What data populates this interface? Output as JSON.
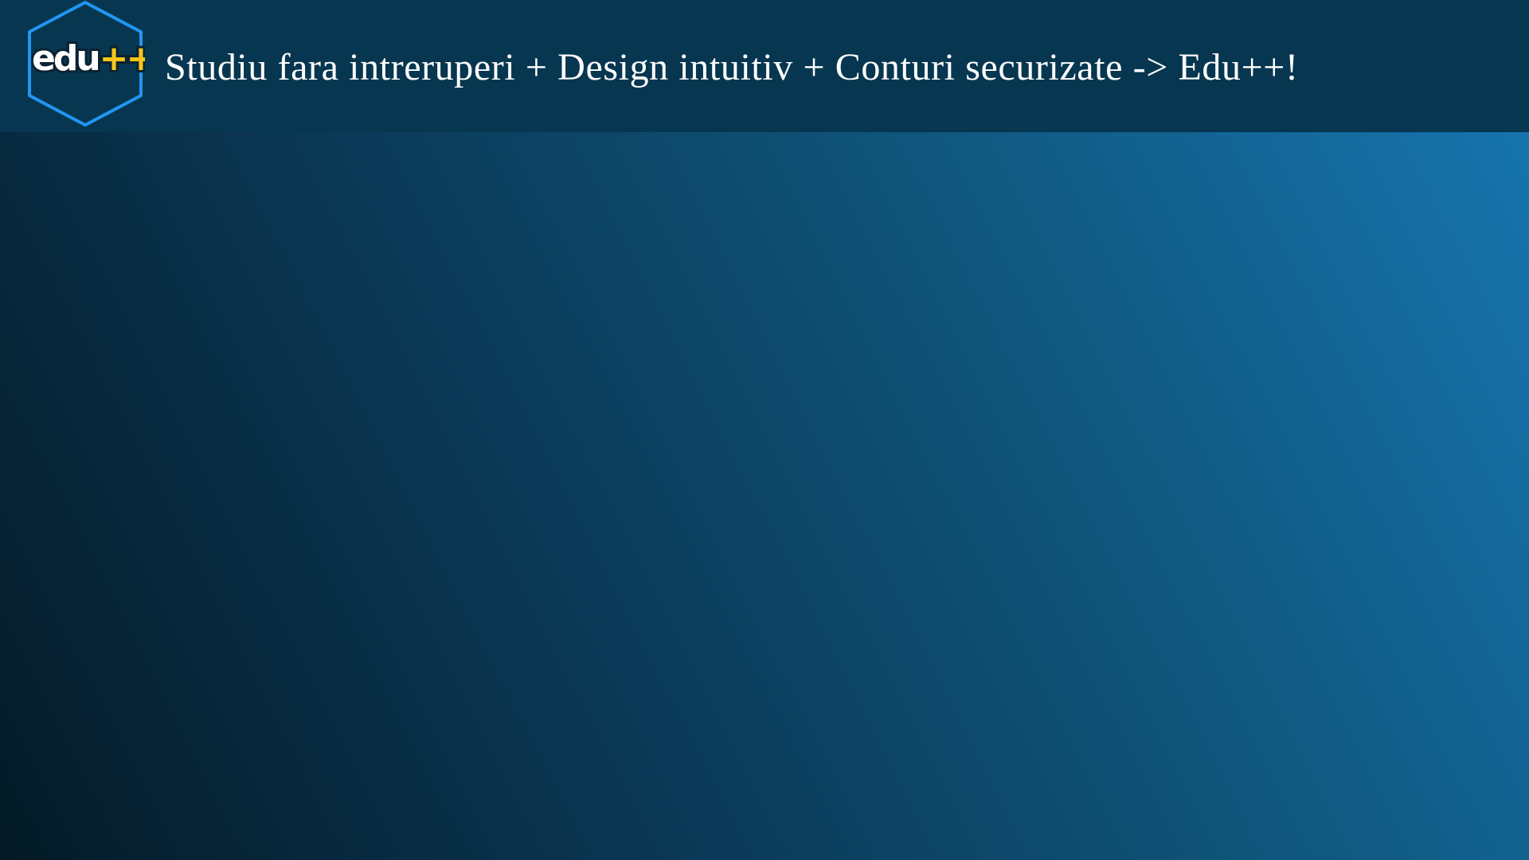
{
  "header": {
    "logo": {
      "text_main": "edu",
      "text_accent": "++",
      "icon": "hexagon-logo",
      "colors": {
        "outline": "#2196f3",
        "main_text": "#ffffff",
        "accent_text": "#f5c518"
      }
    },
    "tagline": "Studiu fara intreruperi + Design intuitiv + Conturi securizate -> Edu++!"
  },
  "theme": {
    "header_background": "#073650",
    "background_gradient": [
      "#041a26",
      "#0a3552",
      "#0f5378",
      "#1777b3"
    ]
  }
}
